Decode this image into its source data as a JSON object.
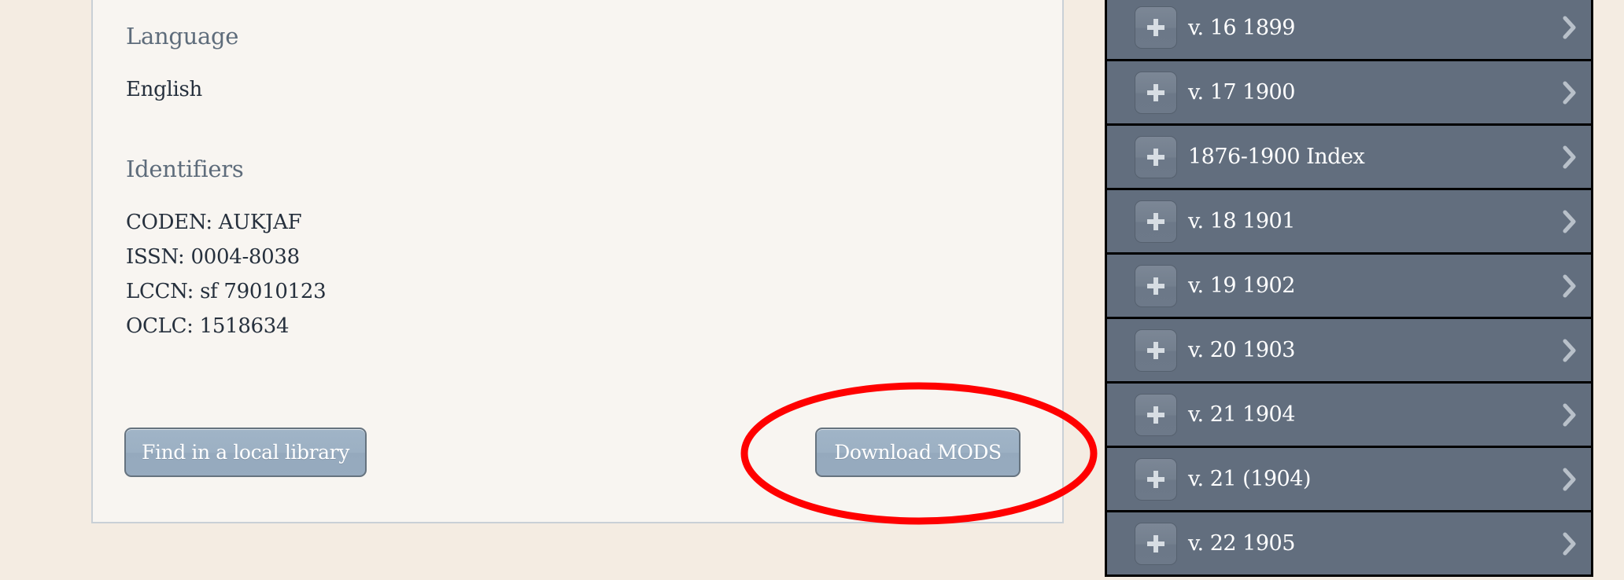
{
  "record": {
    "language": {
      "heading": "Language",
      "value": "English"
    },
    "identifiers": {
      "heading": "Identifiers",
      "items": [
        "CODEN: AUKJAF",
        "ISSN: 0004-8038",
        "LCCN: sf 79010123",
        "OCLC: 1518634"
      ]
    },
    "actions": {
      "find_library_label": "Find in a local library",
      "download_mods_label": "Download MODS"
    }
  },
  "volumes": {
    "items": [
      {
        "label": "v. 16 1899",
        "icon": "plus-icon",
        "chevron": "chevron-right-icon"
      },
      {
        "label": "v. 17 1900",
        "icon": "plus-icon",
        "chevron": "chevron-right-icon"
      },
      {
        "label": "1876-1900 Index",
        "icon": "plus-icon",
        "chevron": "chevron-right-icon"
      },
      {
        "label": "v. 18 1901",
        "icon": "plus-icon",
        "chevron": "chevron-right-icon"
      },
      {
        "label": "v. 19 1902",
        "icon": "plus-icon",
        "chevron": "chevron-right-icon"
      },
      {
        "label": "v. 20 1903",
        "icon": "plus-icon",
        "chevron": "chevron-right-icon"
      },
      {
        "label": "v. 21 1904",
        "icon": "plus-icon",
        "chevron": "chevron-right-icon"
      },
      {
        "label": "v. 21 (1904)",
        "icon": "plus-icon",
        "chevron": "chevron-right-icon"
      },
      {
        "label": "v. 22 1905",
        "icon": "plus-icon",
        "chevron": "chevron-right-icon"
      }
    ]
  },
  "annotation": {
    "shape": "ellipse",
    "target": "download-mods-button",
    "color": "#ff0000"
  },
  "colors": {
    "page_background": "#f4ece2",
    "card_background": "#f8f5f1",
    "sidebar_row": "#626e7e",
    "button": "#9cb0c3",
    "heading_text": "#5e6c7b",
    "body_text": "#26303d"
  }
}
